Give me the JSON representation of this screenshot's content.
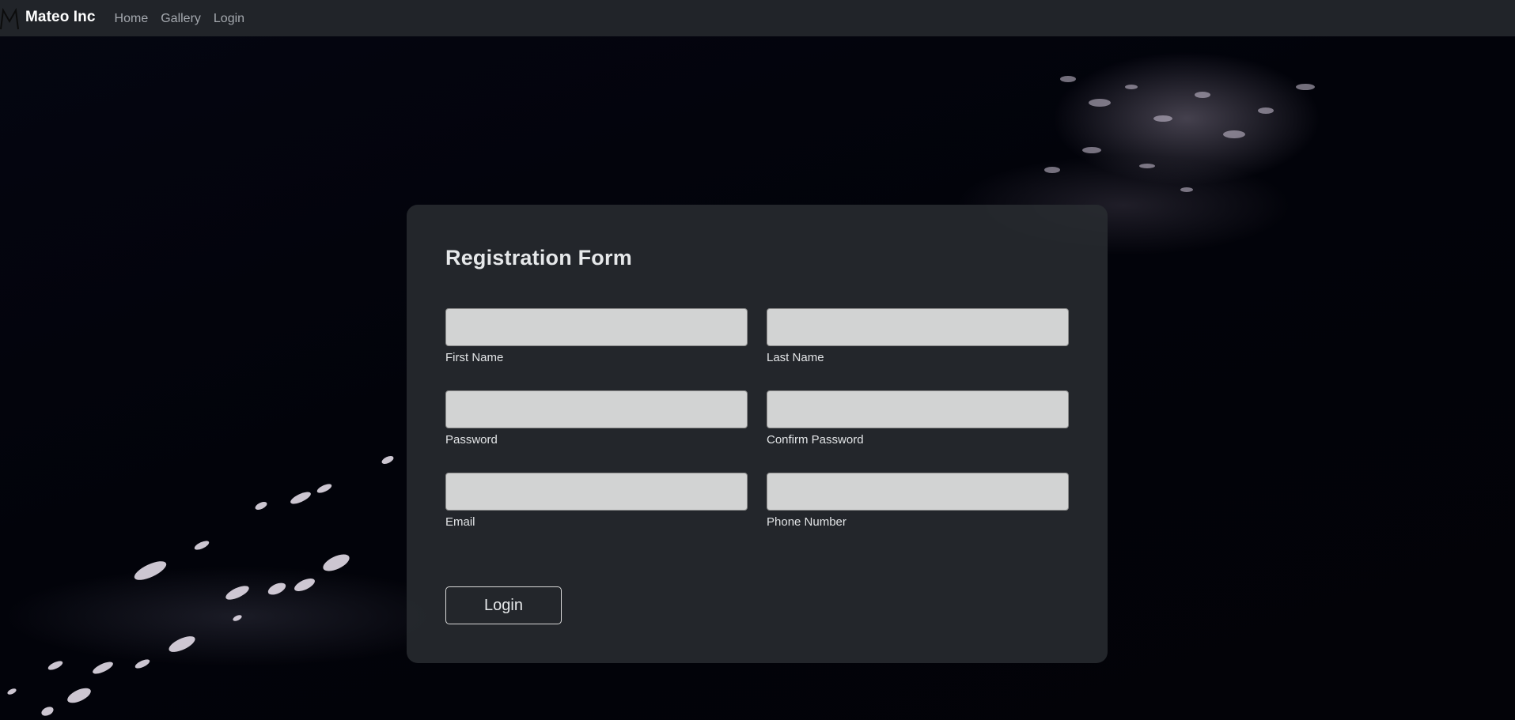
{
  "navbar": {
    "brand": "Mateo Inc",
    "logo_icon": "m-logo-icon",
    "links": [
      {
        "label": "Home"
      },
      {
        "label": "Gallery"
      },
      {
        "label": "Login"
      }
    ],
    "background_color": "#212429"
  },
  "form": {
    "title": "Registration Form",
    "fields": {
      "first_name": {
        "label": "First Name",
        "value": ""
      },
      "last_name": {
        "label": "Last Name",
        "value": ""
      },
      "password": {
        "label": "Password",
        "value": ""
      },
      "confirm_password": {
        "label": "Confirm Password",
        "value": ""
      },
      "email": {
        "label": "Email",
        "value": ""
      },
      "phone": {
        "label": "Phone Number",
        "value": ""
      }
    },
    "submit_label": "Login",
    "card_color": "#282b30"
  }
}
